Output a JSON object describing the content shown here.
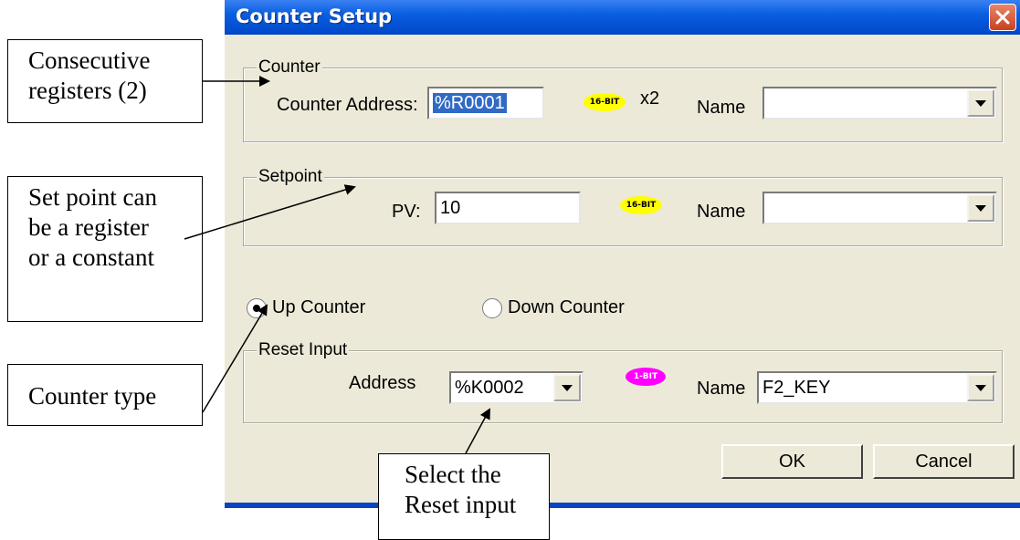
{
  "dialog": {
    "title": "Counter Setup",
    "counter": {
      "legend": "Counter",
      "address_label": "Counter Address:",
      "address_value": "%R0001",
      "badge": "16-BIT",
      "multiplier": "x2",
      "name_label": "Name",
      "name_value": ""
    },
    "setpoint": {
      "legend": "Setpoint",
      "pv_label": "PV:",
      "pv_value": "10",
      "badge": "16-BIT",
      "name_label": "Name",
      "name_value": ""
    },
    "mode": {
      "up_label": "Up Counter",
      "down_label": "Down Counter",
      "selected": "up"
    },
    "reset": {
      "legend": "Reset Input",
      "address_label": "Address",
      "address_value": "%K0002",
      "badge": "1-BIT",
      "name_label": "Name",
      "name_value": "F2_KEY"
    },
    "ok_label": "OK",
    "cancel_label": "Cancel"
  },
  "annotations": {
    "consecutive": [
      "Consecutive",
      "registers (2)"
    ],
    "setpoint": [
      "Set point can",
      "be a register",
      "or a constant"
    ],
    "counter_type": [
      "Counter type"
    ],
    "reset": [
      "Select the",
      "Reset input"
    ]
  },
  "colors": {
    "titlebar": "#0a5fe0",
    "badge_16bit": "#ffff00",
    "badge_1bit": "#ff00ff",
    "selection": "#316ac5"
  },
  "icons": {
    "close": "close-icon",
    "dropdown": "chevron-down-icon"
  }
}
